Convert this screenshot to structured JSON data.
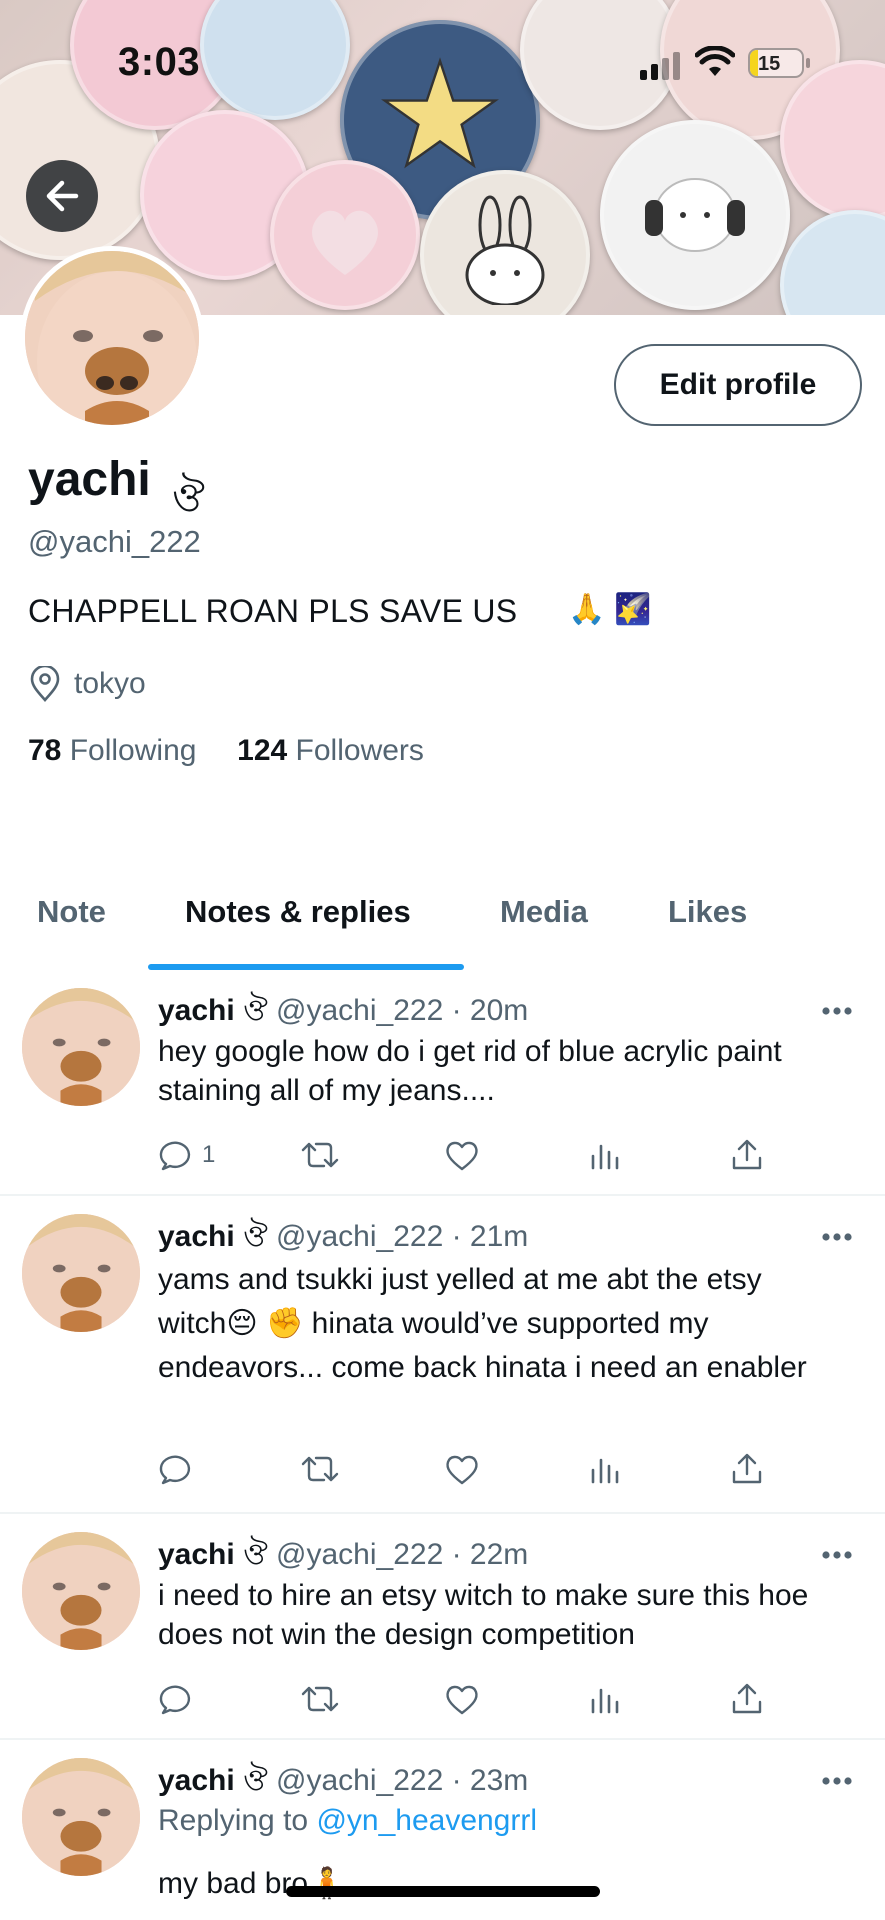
{
  "status_bar": {
    "time": "3:03",
    "battery": "15",
    "battery_level": 0.15
  },
  "profile": {
    "display_name": "yachi",
    "name_emoji": "ঔ",
    "handle": "@yachi_222",
    "bio": "CHAPPELL ROAN PLS SAVE US",
    "bio_emojis": [
      "🙏",
      "🌠"
    ],
    "location": "tokyo",
    "following_count": "78",
    "following_label": "Following",
    "followers_count": "124",
    "followers_label": "Followers",
    "edit_button": "Edit profile"
  },
  "tabs": [
    {
      "label": "Note",
      "active": false
    },
    {
      "label": "Notes & replies",
      "active": true
    },
    {
      "label": "Media",
      "active": false
    },
    {
      "label": "Likes",
      "active": false
    }
  ],
  "posts": [
    {
      "name": "yachi",
      "emoji": "ঔ",
      "meta": "@yachi_222 · 20m",
      "text": "hey google how do i get rid of blue acrylic paint staining all of my jeans....",
      "reply_count": "1"
    },
    {
      "name": "yachi",
      "emoji": "ঔ",
      "meta": "@yachi_222 · 21m",
      "text": "yams and tsukki just yelled at me abt the etsy witch😔 ✊  hinata would’ve supported my endeavors... come back hinata i need an enabler",
      "reply_count": ""
    },
    {
      "name": "yachi",
      "emoji": "ঔ",
      "meta": "@yachi_222 · 22m",
      "text": "i need to hire an etsy witch to make sure this hoe does not win the design competition",
      "reply_count": ""
    },
    {
      "name": "yachi",
      "emoji": "ঔ",
      "meta": "@yachi_222 · 23m",
      "replying_label": "Replying to",
      "replying_to": "@yn_heavengrrl",
      "text": "my bad bro🧍"
    }
  ],
  "colors": {
    "accent": "#1d9bf0",
    "secondary_text": "#536471",
    "primary_text": "#0f1419"
  }
}
